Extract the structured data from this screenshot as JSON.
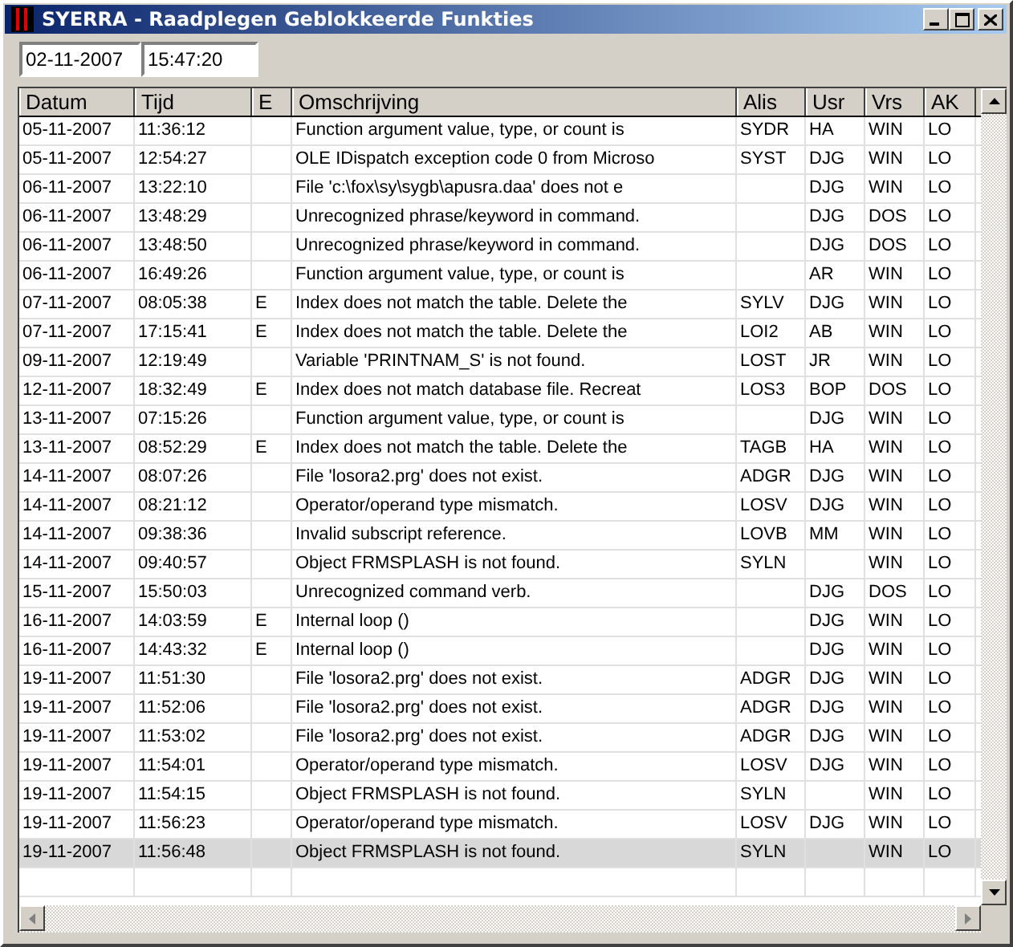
{
  "window": {
    "title": "SYERRA - Raadplegen Geblokkeerde Funkties"
  },
  "date_field": {
    "value": "02-11-2007"
  },
  "time_field": {
    "value": "15:47:20"
  },
  "table": {
    "columns": [
      "Datum",
      "Tijd",
      "E",
      "Omschrijving",
      "Alis",
      "Usr",
      "Vrs",
      "AK"
    ],
    "rows": [
      {
        "datum": "05-11-2007",
        "tijd": "11:36:12",
        "omschrijving": "Function argument value, type, or count is",
        "alis": "SYDR",
        "usr": "HA",
        "vrs": "WIN",
        "ak": "LO",
        "selected": false
      },
      {
        "datum": "05-11-2007",
        "tijd": "12:54:27",
        "omschrijving": "OLE IDispatch exception code 0 from Microso",
        "alis": "SYST",
        "usr": "DJG",
        "vrs": "WIN",
        "ak": "LO",
        "selected": false
      },
      {
        "datum": "06-11-2007",
        "tijd": "13:22:10",
        "omschrijving": "File 'c:\\fox\\sy\\sygb\\apusra.daa' does not e",
        "usr": "DJG",
        "vrs": "WIN",
        "ak": "LO",
        "selected": false
      },
      {
        "datum": "06-11-2007",
        "tijd": "13:48:29",
        "omschrijving": "Unrecognized phrase/keyword in command.",
        "usr": "DJG",
        "vrs": "DOS",
        "ak": "LO",
        "selected": false
      },
      {
        "datum": "06-11-2007",
        "tijd": "13:48:50",
        "omschrijving": "Unrecognized phrase/keyword in command.",
        "usr": "DJG",
        "vrs": "DOS",
        "ak": "LO",
        "selected": false
      },
      {
        "datum": "06-11-2007",
        "tijd": "16:49:26",
        "omschrijving": "Function argument value, type, or count is",
        "usr": "AR",
        "vrs": "WIN",
        "ak": "LO",
        "selected": false
      },
      {
        "datum": "07-11-2007",
        "tijd": "08:05:38",
        "e": "E",
        "omschrijving": "Index does not match the table. Delete the",
        "alis": "SYLV",
        "usr": "DJG",
        "vrs": "WIN",
        "ak": "LO",
        "selected": false
      },
      {
        "datum": "07-11-2007",
        "tijd": "17:15:41",
        "e": "E",
        "omschrijving": "Index does not match the table. Delete the",
        "alis": "LOI2",
        "usr": "AB",
        "vrs": "WIN",
        "ak": "LO",
        "selected": false
      },
      {
        "datum": "09-11-2007",
        "tijd": "12:19:49",
        "omschrijving": "Variable 'PRINTNAM_S' is not found.",
        "alis": "LOST",
        "usr": "JR",
        "vrs": "WIN",
        "ak": "LO",
        "selected": false
      },
      {
        "datum": "12-11-2007",
        "tijd": "18:32:49",
        "e": "E",
        "omschrijving": "Index does not match database file. Recreat",
        "alis": "LOS3",
        "usr": "BOP",
        "vrs": "DOS",
        "ak": "LO",
        "selected": false
      },
      {
        "datum": "13-11-2007",
        "tijd": "07:15:26",
        "omschrijving": "Function argument value, type, or count is",
        "usr": "DJG",
        "vrs": "WIN",
        "ak": "LO",
        "selected": false
      },
      {
        "datum": "13-11-2007",
        "tijd": "08:52:29",
        "e": "E",
        "omschrijving": "Index does not match the table. Delete the",
        "alis": "TAGB",
        "usr": "HA",
        "vrs": "WIN",
        "ak": "LO",
        "selected": false
      },
      {
        "datum": "14-11-2007",
        "tijd": "08:07:26",
        "omschrijving": "File 'losora2.prg' does not exist.",
        "alis": "ADGR",
        "usr": "DJG",
        "vrs": "WIN",
        "ak": "LO",
        "selected": false
      },
      {
        "datum": "14-11-2007",
        "tijd": "08:21:12",
        "omschrijving": "Operator/operand type mismatch.",
        "alis": "LOSV",
        "usr": "DJG",
        "vrs": "WIN",
        "ak": "LO",
        "selected": false
      },
      {
        "datum": "14-11-2007",
        "tijd": "09:38:36",
        "omschrijving": "Invalid subscript reference.",
        "alis": "LOVB",
        "usr": "MM",
        "vrs": "WIN",
        "ak": "LO",
        "selected": false
      },
      {
        "datum": "14-11-2007",
        "tijd": "09:40:57",
        "omschrijving": "Object FRMSPLASH is not found.",
        "alis": "SYLN",
        "vrs": "WIN",
        "ak": "LO",
        "selected": false
      },
      {
        "datum": "15-11-2007",
        "tijd": "15:50:03",
        "omschrijving": "Unrecognized command verb.",
        "usr": "DJG",
        "vrs": "DOS",
        "ak": "LO",
        "selected": false
      },
      {
        "datum": "16-11-2007",
        "tijd": "14:03:59",
        "e": "E",
        "omschrijving": "Internal loop ()",
        "usr": "DJG",
        "vrs": "WIN",
        "ak": "LO",
        "selected": false
      },
      {
        "datum": "16-11-2007",
        "tijd": "14:43:32",
        "e": "E",
        "omschrijving": "Internal loop ()",
        "usr": "DJG",
        "vrs": "WIN",
        "ak": "LO",
        "selected": false
      },
      {
        "datum": "19-11-2007",
        "tijd": "11:51:30",
        "omschrijving": "File 'losora2.prg' does not exist.",
        "alis": "ADGR",
        "usr": "DJG",
        "vrs": "WIN",
        "ak": "LO",
        "selected": false
      },
      {
        "datum": "19-11-2007",
        "tijd": "11:52:06",
        "omschrijving": "File 'losora2.prg' does not exist.",
        "alis": "ADGR",
        "usr": "DJG",
        "vrs": "WIN",
        "ak": "LO",
        "selected": false
      },
      {
        "datum": "19-11-2007",
        "tijd": "11:53:02",
        "omschrijving": "File 'losora2.prg' does not exist.",
        "alis": "ADGR",
        "usr": "DJG",
        "vrs": "WIN",
        "ak": "LO",
        "selected": false
      },
      {
        "datum": "19-11-2007",
        "tijd": "11:54:01",
        "omschrijving": "Operator/operand type mismatch.",
        "alis": "LOSV",
        "usr": "DJG",
        "vrs": "WIN",
        "ak": "LO",
        "selected": false
      },
      {
        "datum": "19-11-2007",
        "tijd": "11:54:15",
        "omschrijving": "Object FRMSPLASH is not found.",
        "alis": "SYLN",
        "vrs": "WIN",
        "ak": "LO",
        "selected": false
      },
      {
        "datum": "19-11-2007",
        "tijd": "11:56:23",
        "omschrijving": "Operator/operand type mismatch.",
        "alis": "LOSV",
        "usr": "DJG",
        "vrs": "WIN",
        "ak": "LO",
        "selected": false
      },
      {
        "datum": "19-11-2007",
        "tijd": "11:56:48",
        "omschrijving": "Object FRMSPLASH is not found.",
        "alis": "SYLN",
        "vrs": "WIN",
        "ak": "LO",
        "selected": true
      }
    ]
  }
}
